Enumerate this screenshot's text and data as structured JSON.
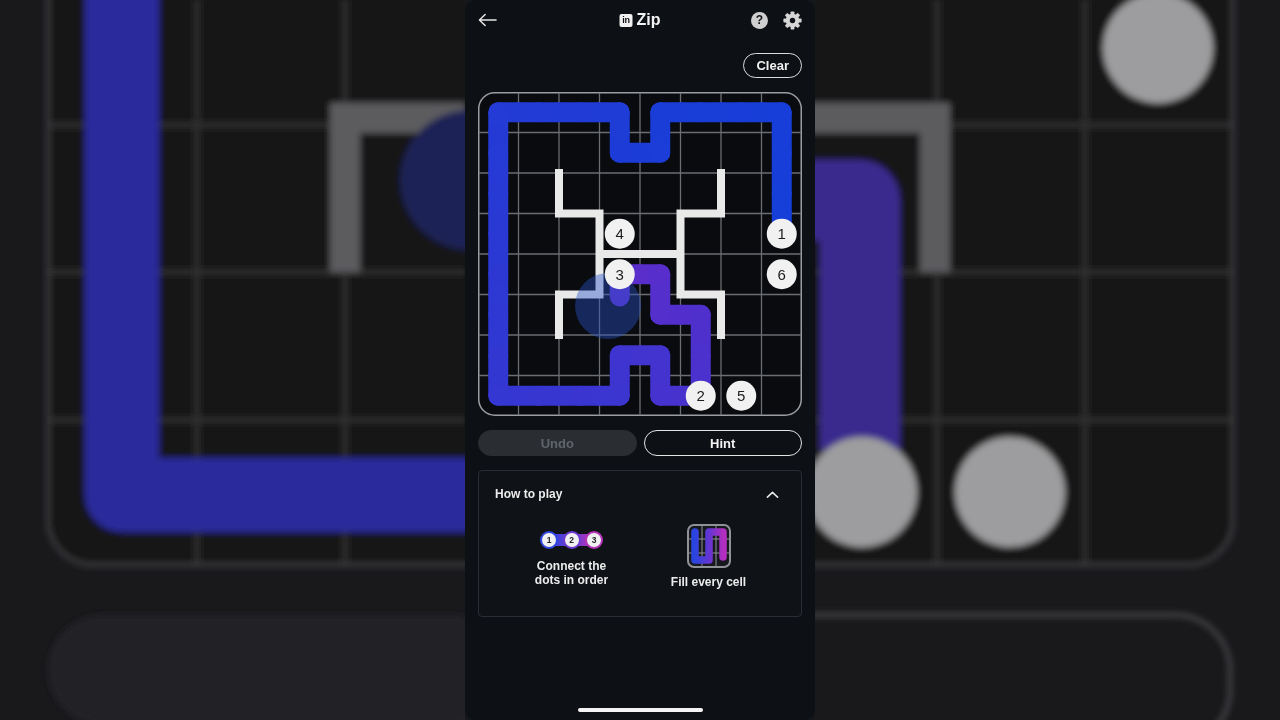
{
  "header": {
    "logo": "in",
    "title": "Zip",
    "help": "?"
  },
  "clear_button": {
    "label": "Clear"
  },
  "board": {
    "dots": [
      {
        "label": "4"
      },
      {
        "label": "1"
      },
      {
        "label": "3"
      },
      {
        "label": "6"
      },
      {
        "label": "2"
      },
      {
        "label": "5"
      }
    ]
  },
  "actions": [
    {
      "label": "Undo",
      "disabled": true
    },
    {
      "label": "Hint",
      "disabled": false
    }
  ],
  "how_to_play": {
    "title": "How to play",
    "expanded": true,
    "tips": [
      {
        "kind": "dots",
        "dots": [
          {
            "label": "1",
            "color": "#2d46e0"
          },
          {
            "label": "2",
            "color": "#6b3bd0"
          },
          {
            "label": "3",
            "color": "#b533b8"
          }
        ],
        "label": "Connect the dots in order"
      },
      {
        "kind": "fill",
        "label": "Fill every cell"
      }
    ]
  }
}
